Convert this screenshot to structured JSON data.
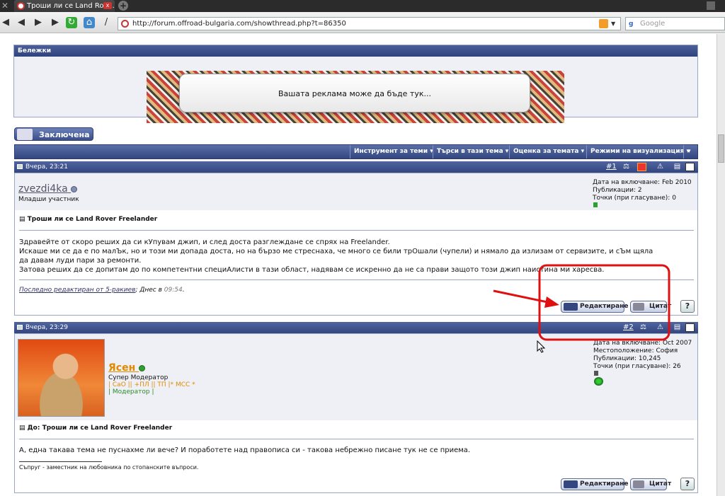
{
  "browser": {
    "tab_title": "Троши ли се Land Rove...",
    "tab_close": "x",
    "newtab": "+",
    "url": "http://forum.offroad-bulgaria.com/showthread.php?t=86350",
    "search_placeholder": "Google",
    "search_engine_letter": "g"
  },
  "notes_panel": {
    "title": "Бележки",
    "ad_text": "Вашата реклама може да бъде тук..."
  },
  "locked_button": "Заключена",
  "thread_toolbar": {
    "items": [
      "Инструмент за теми ▾",
      "Търси в тази тема ▾",
      "Оценка за темата ▾",
      "Режими на визуализация ▾",
      "▾"
    ]
  },
  "posts": [
    {
      "date": "Вчера, 23:21",
      "number": "#1",
      "username": "zvezdi4ka",
      "user_title": "Младши участник",
      "join_date": "Дата на включване: Feb 2010",
      "posts": "Публикации: 2",
      "points": "Точки (при гласуване): 0",
      "title": "Троши ли се Land Rover Freelander",
      "body_lines": [
        "Здравейте от скоро реших да си кУпувам джип, и след доста разглеждане се спрях на Freelander.",
        "Искаше ми се да е по малЪк, но и този ми допада доста, но на бързо ме стреснаха, че много се били трОшали (чупели) и нямало да излизам от сервизите, и сЪм щяла",
        "да давам луди пари за ремонти.",
        "Затова реших да се допитам до по компетентни специАлисти в тази област, надявам се искренно да не са прави защото този джип наистина ми харесва."
      ],
      "edited_link": "Последно редактиран от 5-ракиев",
      "edited_rest": "; Днес в ",
      "edited_time": "09:54",
      "edited_end": ".",
      "edit_label": "Редактиране",
      "quote_label": "Цитат"
    },
    {
      "date": "Вчера, 23:29",
      "number": "#2",
      "username": "Ясен",
      "user_title": "Супер Модератор",
      "roles_line1": "| СаО || +ПЛ || ТП |* МСС *",
      "roles_line2": "| Модератор |",
      "join_date": "Дата на включване: Oct 2007",
      "location": "Местоположение: София",
      "posts": "Публикации: 10,245",
      "points": "Точки (при гласуване): 26",
      "title": "До: Троши ли се Land Rover Freelander",
      "body": "А, една такава тема не пуснахме ли вече? И поработете над правописа си - такова небрежно писане тук не се приема.",
      "signature": "Съпруг - заместник на любовника по стопанските въпроси.",
      "edit_label": "Редактиране",
      "quote_label": "Цитат"
    }
  ],
  "colors": {
    "header_blue": "#33467f",
    "annotation_red": "#e01010",
    "online_green": "#2fa02f"
  }
}
